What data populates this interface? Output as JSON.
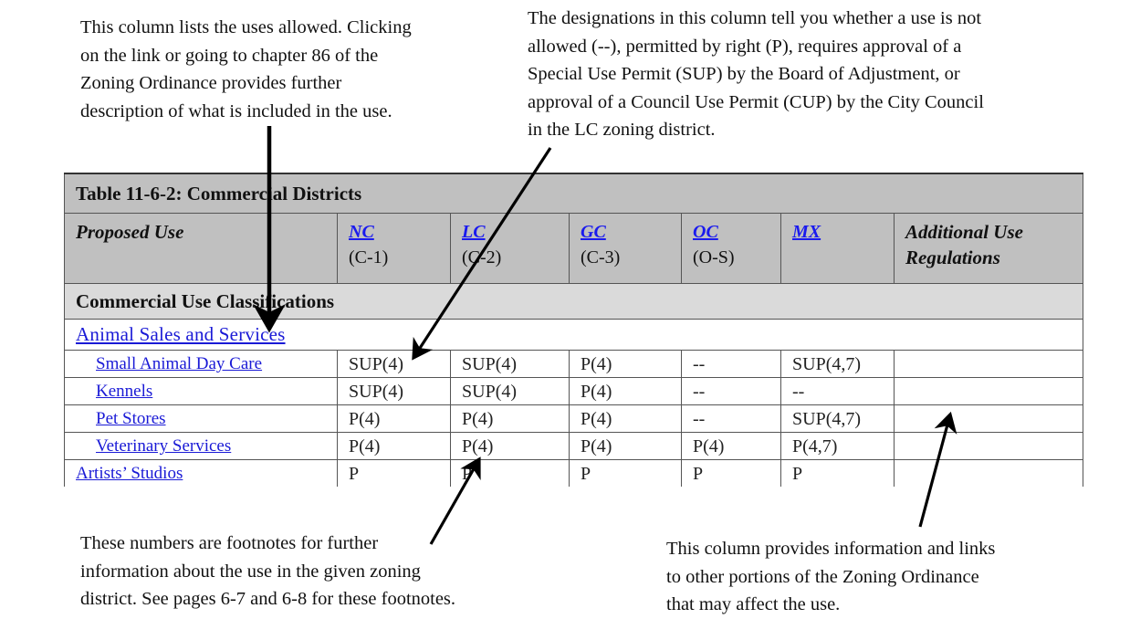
{
  "annotations": {
    "top_left": [
      "This column lists the uses allowed.  Clicking",
      "on the link or going to chapter 86 of the",
      "Zoning Ordinance provides further",
      "description of what is included in the use."
    ],
    "top_right": [
      "The designations in this column tell you whether a use is not",
      "allowed (--), permitted by right (P), requires approval of a",
      "Special Use Permit (SUP) by the Board of Adjustment, or",
      "approval of a Council Use Permit (CUP) by the City Council",
      "in the LC zoning district."
    ],
    "bottom_left": [
      "These numbers are footnotes for further",
      "information about the use in the given zoning",
      "district.  See pages 6-7 and 6-8 for these footnotes."
    ],
    "bottom_right": [
      "This column provides information and links",
      "to other portions of the Zoning Ordinance",
      "that may affect the use."
    ]
  },
  "table": {
    "title": "Table 11-6-2: Commercial Districts",
    "header": {
      "proposed_use": "Proposed Use",
      "districts": [
        {
          "code": "NC",
          "sub": "(C-1)"
        },
        {
          "code": "LC",
          "sub": "(C-2)"
        },
        {
          "code": "GC",
          "sub": "(C-3)"
        },
        {
          "code": "OC",
          "sub": "(O-S)"
        },
        {
          "code": "MX",
          "sub": ""
        }
      ],
      "additional": [
        "Additional Use",
        "Regulations"
      ]
    },
    "classification": "Commercial Use Classifications",
    "group": "Animal Sales and Services",
    "rows": [
      {
        "use": "Small Animal Day Care",
        "values": [
          "SUP(4)",
          "SUP(4)",
          "P(4)",
          "--",
          "SUP(4,7)"
        ],
        "additional": ""
      },
      {
        "use": "Kennels",
        "values": [
          "SUP(4)",
          "SUP(4)",
          "P(4)",
          "--",
          "--"
        ],
        "additional": ""
      },
      {
        "use": "Pet Stores",
        "values": [
          "P(4)",
          "P(4)",
          "P(4)",
          "--",
          "SUP(4,7)"
        ],
        "additional": ""
      },
      {
        "use": "Veterinary Services",
        "values": [
          "P(4)",
          "P(4)",
          "P(4)",
          "P(4)",
          "P(4,7)"
        ],
        "additional": ""
      }
    ],
    "top_level_rows": [
      {
        "use": "Artists’ Studios",
        "values": [
          "P",
          "P",
          "P",
          "P",
          "P"
        ],
        "additional": ""
      }
    ]
  },
  "colors": {
    "link": "#1a1ad6",
    "header_bg": "#c0c0c0",
    "classification_bg": "#dadada",
    "border": "#555555"
  }
}
